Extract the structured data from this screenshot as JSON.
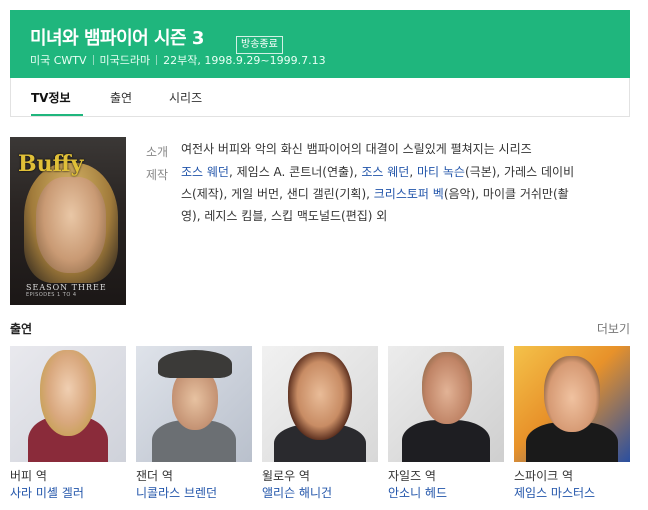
{
  "header": {
    "title": "미녀와 뱀파이어 시즌 3",
    "badge": "방송종료",
    "country_channel": "미국 CWTV",
    "genre": "미국드라마",
    "episodes_period": "22부작, 1998.9.29~1999.7.13"
  },
  "tabs": [
    {
      "label": "TV정보",
      "active": true
    },
    {
      "label": "출연",
      "active": false
    },
    {
      "label": "시리즈",
      "active": false
    }
  ],
  "poster": {
    "logo_text": "Buffy",
    "season_text": "SEASON THREE",
    "episodes_text": "EPISODES 1 TO 4"
  },
  "info": {
    "summary_label": "소개",
    "summary": "여전사 버피와 악의 화신 뱀파이어의 대결이 스릴있게 펼쳐지는 시리즈",
    "production_label": "제작",
    "production": {
      "line1": [
        {
          "text": "조스 웨던",
          "link": true
        },
        {
          "text": ", 제임스 A. 콘트너(연출), ",
          "link": false
        },
        {
          "text": "조스 웨던",
          "link": true
        },
        {
          "text": ", ",
          "link": false
        },
        {
          "text": "마티 녹슨",
          "link": true
        },
        {
          "text": "(극본), 가레스 데이비",
          "link": false
        }
      ],
      "line2": [
        {
          "text": "스(제작), 게일 버먼, 샌디 갤린(기획), ",
          "link": false
        },
        {
          "text": "크리스토퍼 벡",
          "link": true
        },
        {
          "text": "(음악), 마이클 거쉬만(촬",
          "link": false
        }
      ],
      "line3": [
        {
          "text": "영), 레지스 킴블, 스킵 맥도널드(편집) 외",
          "link": false
        }
      ]
    }
  },
  "cast_section": {
    "title": "출연",
    "more_label": "더보기",
    "members": [
      {
        "role": "버피 역",
        "actor": "사라 미셸 겔러"
      },
      {
        "role": "잰더 역",
        "actor": "니콜라스 브렌던"
      },
      {
        "role": "윌로우 역",
        "actor": "앨리슨 해니건"
      },
      {
        "role": "자일즈 역",
        "actor": "안소니 헤드"
      },
      {
        "role": "스파이크 역",
        "actor": "제임스 마스터스"
      }
    ]
  },
  "colors": {
    "brand_green": "#1fb67d",
    "link_blue": "#2255aa"
  }
}
